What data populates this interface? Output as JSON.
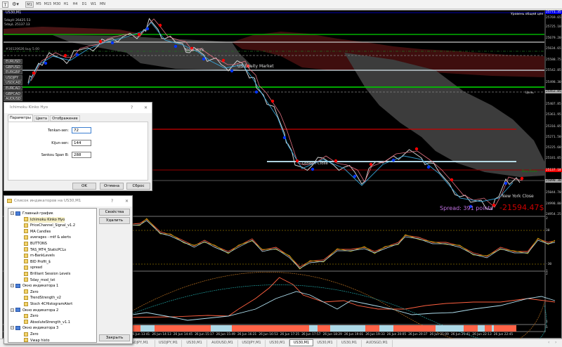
{
  "toolbar": {
    "timeframes": [
      "M1",
      "M5",
      "M15",
      "M30",
      "H1",
      "H4",
      "D1",
      "W1",
      "MN"
    ],
    "active_timeframe": "M1"
  },
  "chart": {
    "title": "US30,M1",
    "stats": {
      "high": "5dayH 26425.53",
      "low": "5dayL 25137.13"
    },
    "order_label": "#16120626 buy 5.00",
    "top_right_label": "Уровень общей цен",
    "target_label": "Цель",
    "buy_zone_label": "Buy Zone",
    "sessions": {
      "new_york": "New York",
      "us_equity": "US Equity Market",
      "london_close": "London Close",
      "new_york_close": "New York Close"
    },
    "spread": "Spread: 391 points",
    "profit": "-21594.47$",
    "symbols": [
      "EURUSD",
      "GBPUSD",
      "EURGBP",
      "USDJPY",
      "USDCAD",
      "EURCAD",
      "GBPCAD",
      "AUDUSD"
    ],
    "price_axis": [
      "25771.35",
      "25769.65",
      "25725.10",
      "25679.20",
      "25634.65",
      "25588.75",
      "25542.85",
      "25498.30",
      "25452.85",
      "25407.85",
      "25361.95",
      "25316.05",
      "25271.50",
      "25225.60",
      "25181.05",
      "25137.18",
      "25090.30",
      "25044.70",
      "24998.80",
      "24954.25"
    ],
    "sub1_axis": [
      "2",
      "30",
      "-30",
      "1"
    ],
    "sub2_axis": [
      "2",
      "1"
    ],
    "sub3_axis": [
      "1"
    ],
    "time_axis": [
      "26 Jun 13:41",
      "26 Jun 14:13",
      "26 Jun 14:45",
      "26 Jun 15:17",
      "26 Jun 15:49",
      "26 Jun 16:21",
      "26 Jun 16:53",
      "26 Jun 17:25",
      "26 Jun 17:57",
      "26 Jun 18:29",
      "26 Jun 19:01",
      "26 Jun 19:33",
      "26 Jun 20:05",
      "26 Jun 20:37",
      "26 Jun 21:09",
      "26 Jun 21:41",
      "26 Jun 22:13",
      "26 Jun 22:45"
    ],
    "colors": {
      "bg": "#000000",
      "price": "#d0d0d0",
      "tenkan": "#e07080",
      "kijun": "#3ab0e8",
      "bull": "#00a000",
      "buy_dot": "#ff0000",
      "sell_dot": "#0033ff",
      "green_level": "#00c000",
      "red_level": "#cc0000",
      "profit": "#cc0000",
      "spread": "#c070e0"
    }
  },
  "tabs": [
    "USDJPY,M1",
    "USDJPY,M1",
    "US30,M1",
    "AUDUSD,M1",
    "USDJPY,M1",
    "US30,M1",
    "US30,M1",
    "US30,M1",
    "US30,M1",
    "AUDSGD,M1"
  ],
  "active_tab": 6,
  "ichimoku_dialog": {
    "title": "Ichimoku Kinko Hyo",
    "help": "?",
    "close": "✕",
    "tabs": [
      "Параметры",
      "Цвета",
      "Отображение"
    ],
    "fields": [
      {
        "label": "Tenkan-sen:",
        "value": "72"
      },
      {
        "label": "Kijun-sen:",
        "value": "144"
      },
      {
        "label": "Senkou Span B:",
        "value": "288"
      }
    ],
    "buttons": {
      "ok": "OK",
      "cancel": "Отмена",
      "reset": "Сброс"
    }
  },
  "indicators_dialog": {
    "title": "Список индикаторов на US30,M1",
    "help": "?",
    "close": "✕",
    "buttons": {
      "properties": "Свойства",
      "delete": "Удалить",
      "close": "Закрыть"
    },
    "groups": [
      {
        "label": "Главный график",
        "items": [
          "Ichimoku Kinko Hyo",
          "PriceChannel_Signal_v1.2",
          "MA Candles",
          "averages - mtf & alerts",
          "BUTTONS",
          "TAS_MT4_StaticPCLs",
          "m-BankLevels",
          "BID Profit_$",
          "spread",
          "Brilliant Session Levels",
          "5day_mod_txt"
        ]
      },
      {
        "label": "Окно индикатора 1",
        "items": [
          "Zero",
          "TrendStrength_v2",
          "Stoch 4CHistogramAlert"
        ]
      },
      {
        "label": "Окно индикатора 2",
        "items": [
          "Zero",
          "AbsoluteStrength_v1.1"
        ]
      },
      {
        "label": "Окно индикатора 3",
        "items": [
          "Zero",
          "Vwap histo"
        ]
      }
    ]
  }
}
